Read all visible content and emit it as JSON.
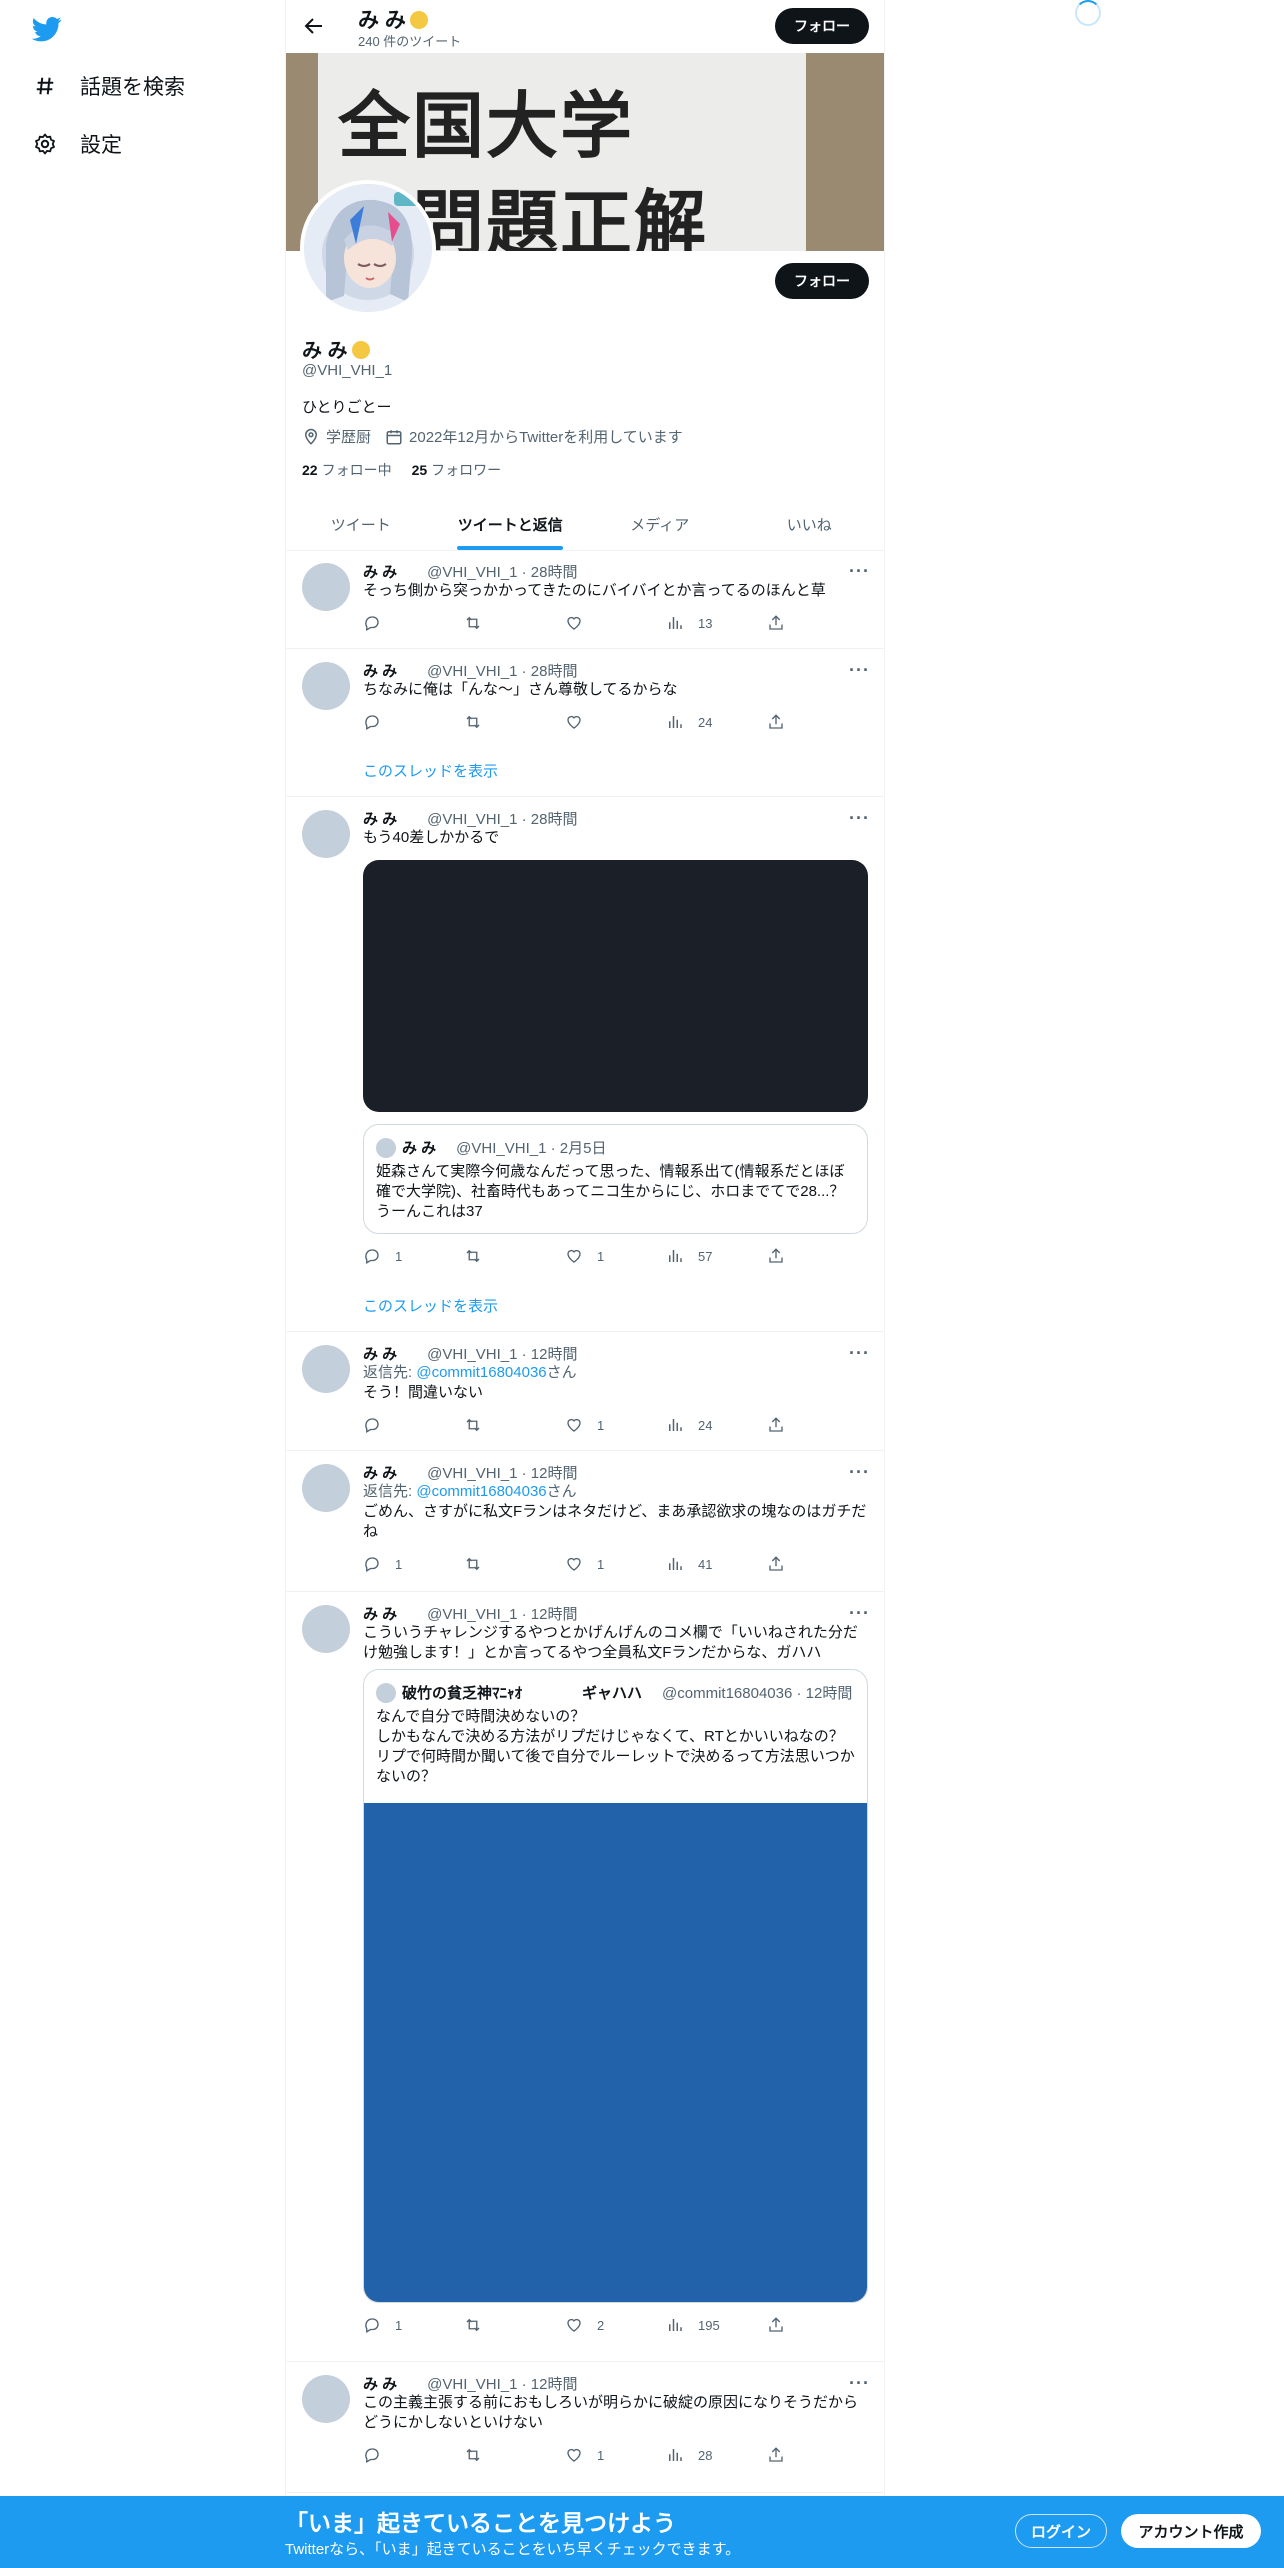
{
  "nav": {
    "explore_label": "話題を検索",
    "settings_label": "設定"
  },
  "header": {
    "name": "み み",
    "tweet_count": "240 件のツイート",
    "follow_label": "フォロー"
  },
  "banner": {
    "line1": "全国大学",
    "line2": "試問題正解"
  },
  "profile": {
    "name": "み み",
    "handle": "@VHI_VHI_1",
    "bio": "ひとりごとー",
    "location": "学歴厨",
    "joined": "2022年12月からTwitterを利用しています",
    "following_count": "22",
    "following_label": "フォロー中",
    "followers_count": "25",
    "followers_label": "フォロワー",
    "follow_label": "フォロー"
  },
  "tabs": [
    {
      "label": "ツイート"
    },
    {
      "label": "ツイートと返信"
    },
    {
      "label": "メディア"
    },
    {
      "label": "いいね"
    }
  ],
  "tweets": [
    {
      "name": "み み",
      "meta": "@VHI_VHI_1 · 28時間",
      "text": "そっち側から突っかかってきたのにバイバイとか言ってるのほんと草",
      "replies": "",
      "likes": "",
      "views": "13"
    },
    {
      "name": "み み",
      "meta": "@VHI_VHI_1 · 28時間",
      "text": "ちなみに俺は「んな〜」さん尊敬してるからな",
      "replies": "",
      "likes": "",
      "views": "24"
    },
    {
      "name": "み み",
      "meta": "@VHI_VHI_1 · 28時間",
      "text": "もう40差しかかるで",
      "replies": "1",
      "likes": "1",
      "views": "57",
      "quote": {
        "name": "み み",
        "meta": "@VHI_VHI_1 · 2月5日",
        "text": "姫森さんて実際今何歳なんだって思った、情報系出て(情報系だとほぼ確で大学院)、社畜時代もあってニコ生からにじ、ホロまでてで28...？うーんこれは37"
      }
    },
    {
      "name": "み み",
      "meta": "@VHI_VHI_1 · 12時間",
      "reply_prefix": "返信先: ",
      "reply_user": "@commit16804036",
      "reply_suffix": "さん",
      "text": "そう！間違いない",
      "replies": "",
      "likes": "1",
      "views": "24"
    },
    {
      "name": "み み",
      "meta": "@VHI_VHI_1 · 12時間",
      "reply_prefix": "返信先: ",
      "reply_user": "@commit16804036",
      "reply_suffix": "さん",
      "text": "ごめん、さすがに私文Fランはネタだけど、まあ承認欲求の塊なのはガチだね",
      "replies": "1",
      "likes": "1",
      "views": "41"
    },
    {
      "name": "み み",
      "meta": "@VHI_VHI_1 · 12時間",
      "text": "こういうチャレンジするやつとかげんげんのコメ欄で「いいねされた分だけ勉強します！」とか言ってるやつ全員私文Fランだからな、ガハハ",
      "replies": "1",
      "likes": "2",
      "views": "195",
      "quote": {
        "name": "破竹の貧乏神ﾏﾆｬｵ　　　　ギャハハ",
        "meta": "@commit16804036 · 12時間",
        "text": "なんで自分で時間決めないの？\nしかもなんで決める方法がリプだけじゃなくて、RTとかいいねなの？\nリプで何時間か聞いて後で自分でルーレットで決めるって方法思いつかないの？"
      }
    },
    {
      "name": "み み",
      "meta": "@VHI_VHI_1 · 12時間",
      "text": "この主義主張する前におもしろいが明らかに破綻の原因になりそうだからどうにかしないといけない",
      "replies": "",
      "likes": "1",
      "views": "28"
    }
  ],
  "thread_link": "このスレッドを表示",
  "bottom": {
    "title": "「いま」起きていることを見つけよう",
    "subtitle": "Twitterなら、「いま」起きていることをいち早くチェックできます。",
    "login": "ログイン",
    "signup": "アカウント作成"
  },
  "colors": {
    "accent": "#1d9bf0",
    "text": "#0f1419",
    "secondary": "#536471",
    "quote_media": "#2162aa"
  }
}
